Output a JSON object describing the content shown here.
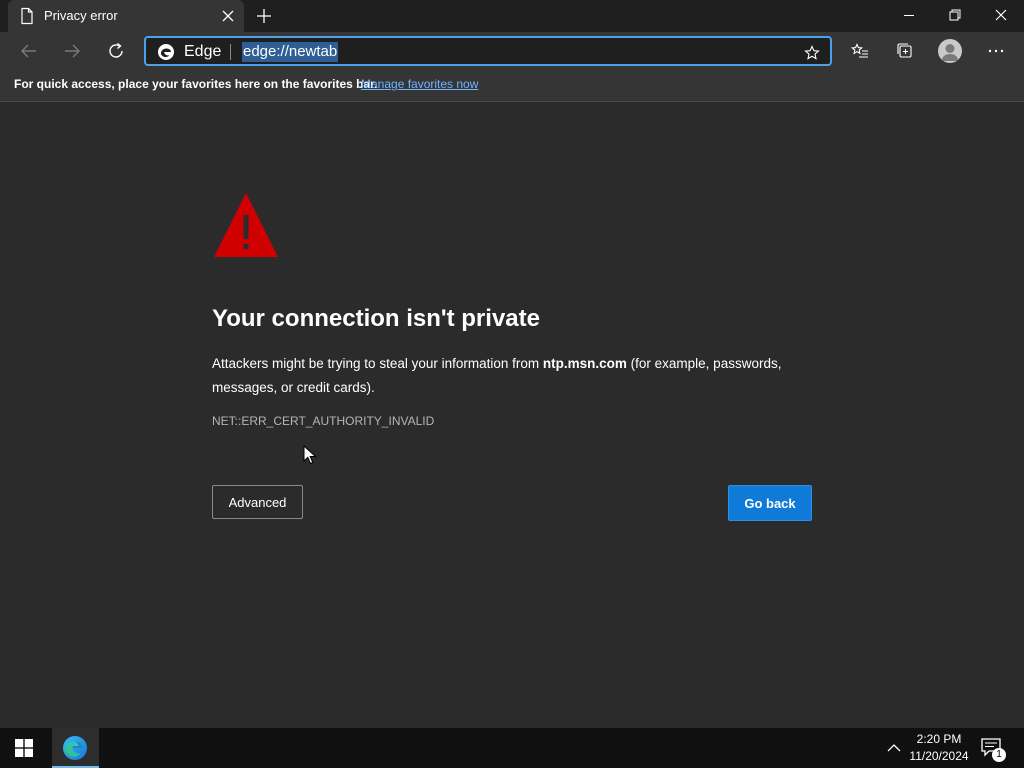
{
  "tab": {
    "title": "Privacy error"
  },
  "address_bar": {
    "site_label": "Edge",
    "url": "edge://newtab"
  },
  "favorites_bar": {
    "message": "For quick access, place your favorites here on the favorites bar.",
    "link": "Manage favorites now"
  },
  "error_page": {
    "heading": "Your connection isn't private",
    "description_before": "Attackers might be trying to steal your information from ",
    "host": "ntp.msn.com",
    "description_after": " (for example, passwords, messages, or credit cards).",
    "error_code": "NET::ERR_CERT_AUTHORITY_INVALID",
    "advanced_button": "Advanced",
    "go_back_button": "Go back"
  },
  "taskbar": {
    "time": "2:20 PM",
    "date": "11/20/2024",
    "notification_count": "1"
  },
  "colors": {
    "accent": "#0f7ad8",
    "warning": "#d00000",
    "link": "#6fb4ff",
    "background": "#2b2b2b"
  },
  "icons": [
    "page-icon",
    "close-icon",
    "plus-icon",
    "minimize-icon",
    "restore-icon",
    "back-arrow-icon",
    "forward-arrow-icon",
    "refresh-icon",
    "edge-icon",
    "star-icon",
    "favorites-icon",
    "collections-icon",
    "avatar-icon",
    "more-icon",
    "warning-icon",
    "windows-start-icon",
    "chevron-up-icon",
    "notification-icon"
  ]
}
